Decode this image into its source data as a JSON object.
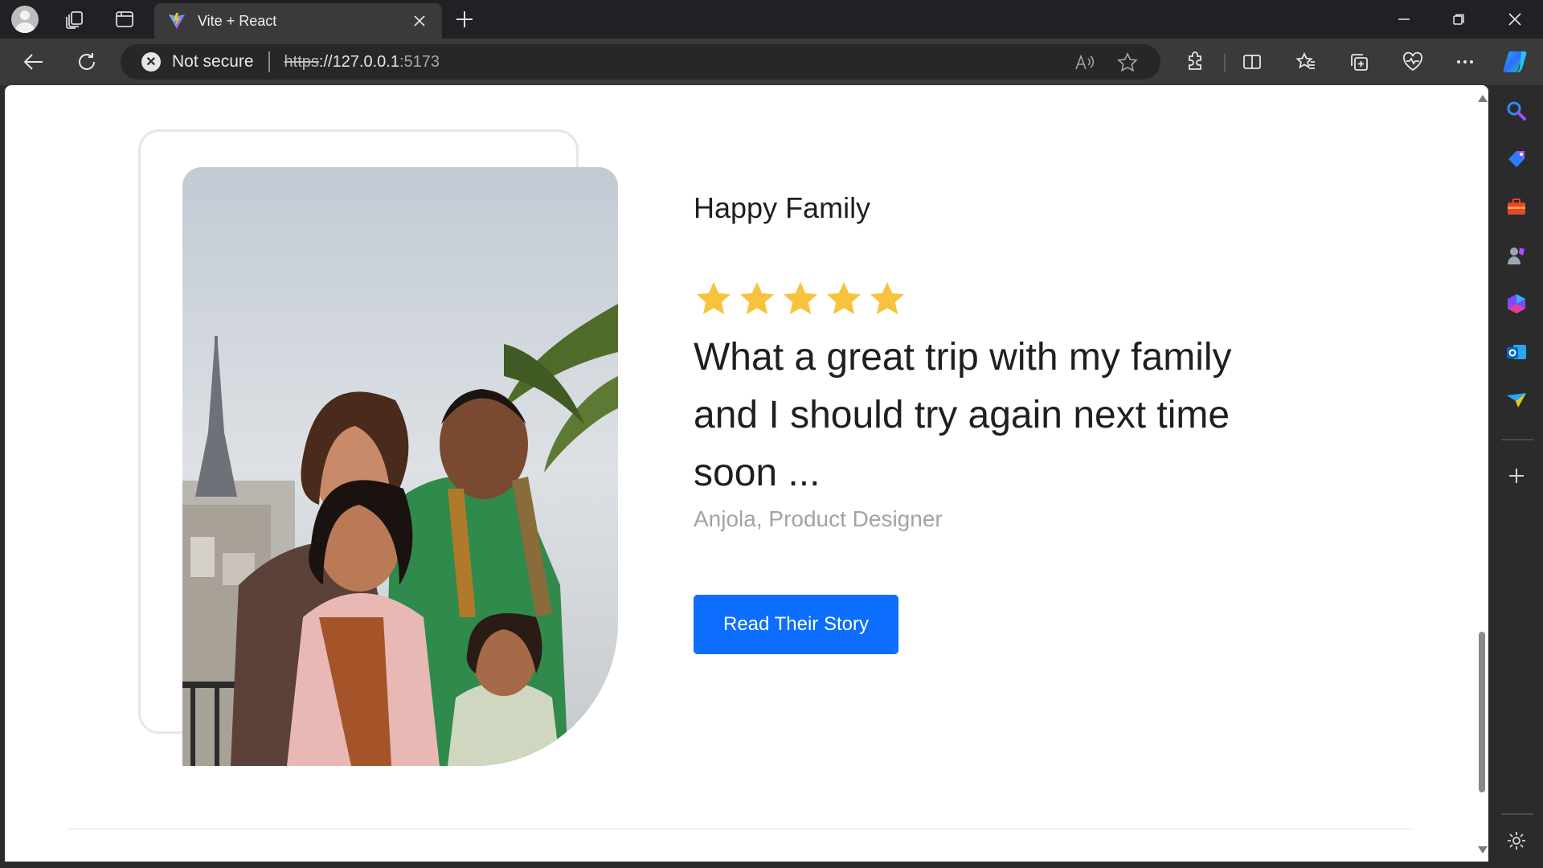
{
  "browser": {
    "tab": {
      "title": "Vite + React"
    },
    "address": {
      "security_label": "Not secure",
      "url_scheme": "https",
      "url_rest": "://127.0.0.1",
      "url_port": ":5173"
    }
  },
  "page": {
    "heading": "Happy Family",
    "rating": 5,
    "quote": "What a great trip with my family and I should try again next time soon ...",
    "author": "Anjola, Product Designer",
    "cta_label": "Read Their Story"
  },
  "colors": {
    "accent": "#0d6efd",
    "star": "#f9c23c",
    "author_text": "#a3a3a3"
  },
  "icons": {
    "titlebar": [
      "profile-icon",
      "workspaces-icon",
      "tab-actions-icon"
    ],
    "toolbar": [
      "back-icon",
      "refresh-icon",
      "read-aloud-icon",
      "favorite-star-icon",
      "extensions-icon",
      "split-screen-icon",
      "favorites-icon",
      "collections-icon",
      "browser-essentials-icon",
      "more-icon",
      "copilot-icon"
    ],
    "sidebar": [
      "search-icon",
      "shopping-icon",
      "tools-icon",
      "games-icon",
      "microsoft-365-icon",
      "outlook-icon",
      "drop-icon",
      "add-icon",
      "settings-icon"
    ]
  }
}
